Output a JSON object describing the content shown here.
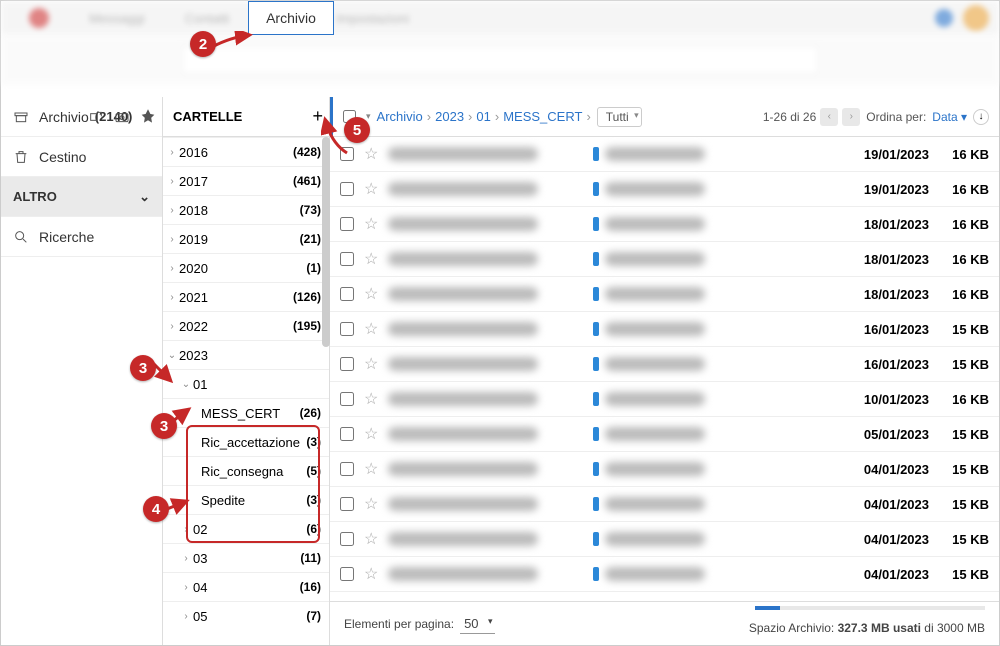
{
  "tab": {
    "active": "Archivio"
  },
  "leftcol": {
    "archive": {
      "label": "Archivio",
      "count": "(2140)"
    },
    "trash": {
      "label": "Cestino"
    },
    "other_section": "ALTRO",
    "search": {
      "label": "Ricerche"
    }
  },
  "midcol": {
    "header": "CARTELLE",
    "years": [
      {
        "label": "2016",
        "count": "(428)",
        "expanded": false
      },
      {
        "label": "2017",
        "count": "(461)",
        "expanded": false
      },
      {
        "label": "2018",
        "count": "(73)",
        "expanded": false
      },
      {
        "label": "2019",
        "count": "(21)",
        "expanded": false
      },
      {
        "label": "2020",
        "count": "(1)",
        "expanded": false
      },
      {
        "label": "2021",
        "count": "(126)",
        "expanded": false
      },
      {
        "label": "2022",
        "count": "(195)",
        "expanded": false
      },
      {
        "label": "2023",
        "count": "",
        "expanded": true
      }
    ],
    "months_2023": [
      {
        "label": "01",
        "expanded": true,
        "subfolders": [
          {
            "label": "MESS_CERT",
            "count": "(26)"
          },
          {
            "label": "Ric_accettazione",
            "count": "(3)"
          },
          {
            "label": "Ric_consegna",
            "count": "(5)"
          },
          {
            "label": "Spedite",
            "count": "(3)"
          }
        ]
      },
      {
        "label": "02",
        "count": "(6)"
      },
      {
        "label": "03",
        "count": "(11)"
      },
      {
        "label": "04",
        "count": "(16)"
      },
      {
        "label": "05",
        "count": "(7)"
      }
    ]
  },
  "breadcrumb": [
    "Archivio",
    "2023",
    "01",
    "MESS_CERT"
  ],
  "filter": "Tutti",
  "pager_text": "1-26 di 26",
  "sort_label": "Ordina per:",
  "sort_value": "Data",
  "messages": [
    {
      "date": "19/01/2023",
      "size": "16 KB"
    },
    {
      "date": "19/01/2023",
      "size": "16 KB"
    },
    {
      "date": "18/01/2023",
      "size": "16 KB"
    },
    {
      "date": "18/01/2023",
      "size": "16 KB"
    },
    {
      "date": "18/01/2023",
      "size": "16 KB"
    },
    {
      "date": "16/01/2023",
      "size": "15 KB"
    },
    {
      "date": "16/01/2023",
      "size": "15 KB"
    },
    {
      "date": "10/01/2023",
      "size": "16 KB"
    },
    {
      "date": "05/01/2023",
      "size": "15 KB"
    },
    {
      "date": "04/01/2023",
      "size": "15 KB"
    },
    {
      "date": "04/01/2023",
      "size": "15 KB"
    },
    {
      "date": "04/01/2023",
      "size": "15 KB"
    },
    {
      "date": "04/01/2023",
      "size": "15 KB"
    }
  ],
  "footer": {
    "per_page_label": "Elementi per pagina:",
    "per_page_value": "50",
    "storage_prefix": "Spazio Archivio: ",
    "storage_used": "327.3 MB usati",
    "storage_suffix": " di 3000 MB"
  },
  "callouts": [
    "2",
    "3",
    "3",
    "4",
    "5"
  ]
}
